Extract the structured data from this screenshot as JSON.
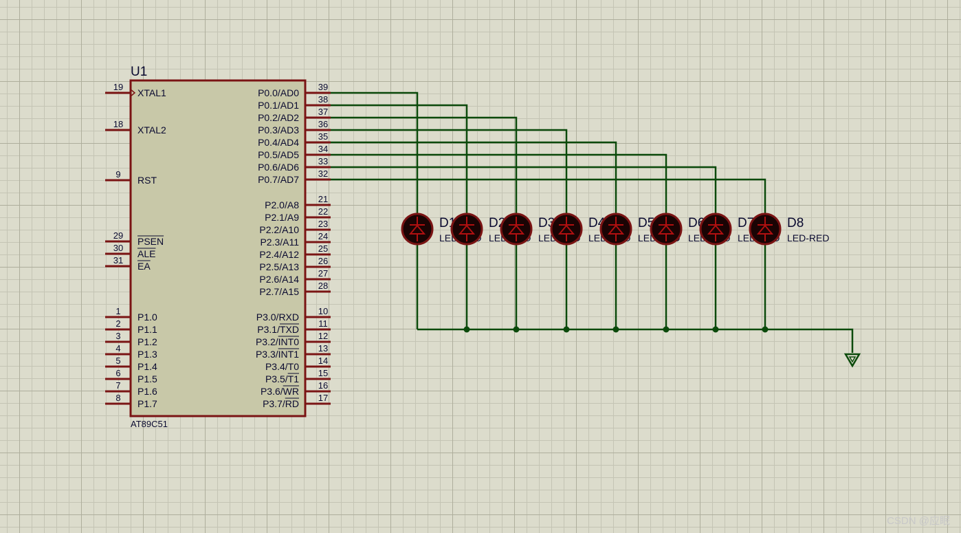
{
  "schematic": {
    "chip": {
      "ref": "U1",
      "part": "AT89C51",
      "left_pins": [
        {
          "num": "19",
          "name": "XTAL1",
          "clock": true
        },
        {
          "num": "18",
          "name": "XTAL2"
        },
        {
          "num": "9",
          "name": "RST"
        },
        {
          "num": "29",
          "name": "PSEN",
          "bar": true
        },
        {
          "num": "30",
          "name": "ALE",
          "bar": true
        },
        {
          "num": "31",
          "name": "EA",
          "bar": true
        },
        {
          "num": "1",
          "name": "P1.0"
        },
        {
          "num": "2",
          "name": "P1.1"
        },
        {
          "num": "3",
          "name": "P1.2"
        },
        {
          "num": "4",
          "name": "P1.3"
        },
        {
          "num": "5",
          "name": "P1.4"
        },
        {
          "num": "6",
          "name": "P1.5"
        },
        {
          "num": "7",
          "name": "P1.6"
        },
        {
          "num": "8",
          "name": "P1.7"
        }
      ],
      "right_pins": [
        {
          "num": "39",
          "name": "P0.0/AD0"
        },
        {
          "num": "38",
          "name": "P0.1/AD1"
        },
        {
          "num": "37",
          "name": "P0.2/AD2"
        },
        {
          "num": "36",
          "name": "P0.3/AD3"
        },
        {
          "num": "35",
          "name": "P0.4/AD4"
        },
        {
          "num": "34",
          "name": "P0.5/AD5"
        },
        {
          "num": "33",
          "name": "P0.6/AD6"
        },
        {
          "num": "32",
          "name": "P0.7/AD7"
        },
        {
          "num": "21",
          "name": "P2.0/A8"
        },
        {
          "num": "22",
          "name": "P2.1/A9"
        },
        {
          "num": "23",
          "name": "P2.2/A10"
        },
        {
          "num": "24",
          "name": "P2.3/A11"
        },
        {
          "num": "25",
          "name": "P2.4/A12"
        },
        {
          "num": "26",
          "name": "P2.5/A13"
        },
        {
          "num": "27",
          "name": "P2.6/A14"
        },
        {
          "num": "28",
          "name": "P2.7/A15"
        },
        {
          "num": "10",
          "name": "P3.0/RXD"
        },
        {
          "num": "11",
          "name": "P3.1/",
          "bar_part": "TXD"
        },
        {
          "num": "12",
          "name": "P3.2/",
          "bar_part": "INT0"
        },
        {
          "num": "13",
          "name": "P3.3/",
          "bar_part": "INT1"
        },
        {
          "num": "14",
          "name": "P3.4/T0"
        },
        {
          "num": "15",
          "name": "P3.5/",
          "bar_part": "T1"
        },
        {
          "num": "16",
          "name": "P3.6/",
          "bar_part": "WR"
        },
        {
          "num": "17",
          "name": "P3.7/",
          "bar_part": "RD"
        }
      ]
    },
    "leds": [
      {
        "ref": "D1",
        "value": "LED-RED"
      },
      {
        "ref": "D2",
        "value": "LED-RED"
      },
      {
        "ref": "D3",
        "value": "LED-RED"
      },
      {
        "ref": "D4",
        "value": "LED-RED"
      },
      {
        "ref": "D5",
        "value": "LED-RED"
      },
      {
        "ref": "D6",
        "value": "LED-RED"
      },
      {
        "ref": "D7",
        "value": "LED-RED"
      },
      {
        "ref": "D8",
        "value": "LED-RED"
      }
    ],
    "colors": {
      "background": "#dcdccc",
      "component_outline": "#7a1414",
      "component_fill": "#c8c8a8",
      "pin": "#7a1414",
      "wire": "#0b4a0b",
      "led_body": "#1a0404",
      "led_glyph": "#b01010",
      "text": "#0a0a30"
    }
  },
  "watermark": "CSDN @应眠"
}
